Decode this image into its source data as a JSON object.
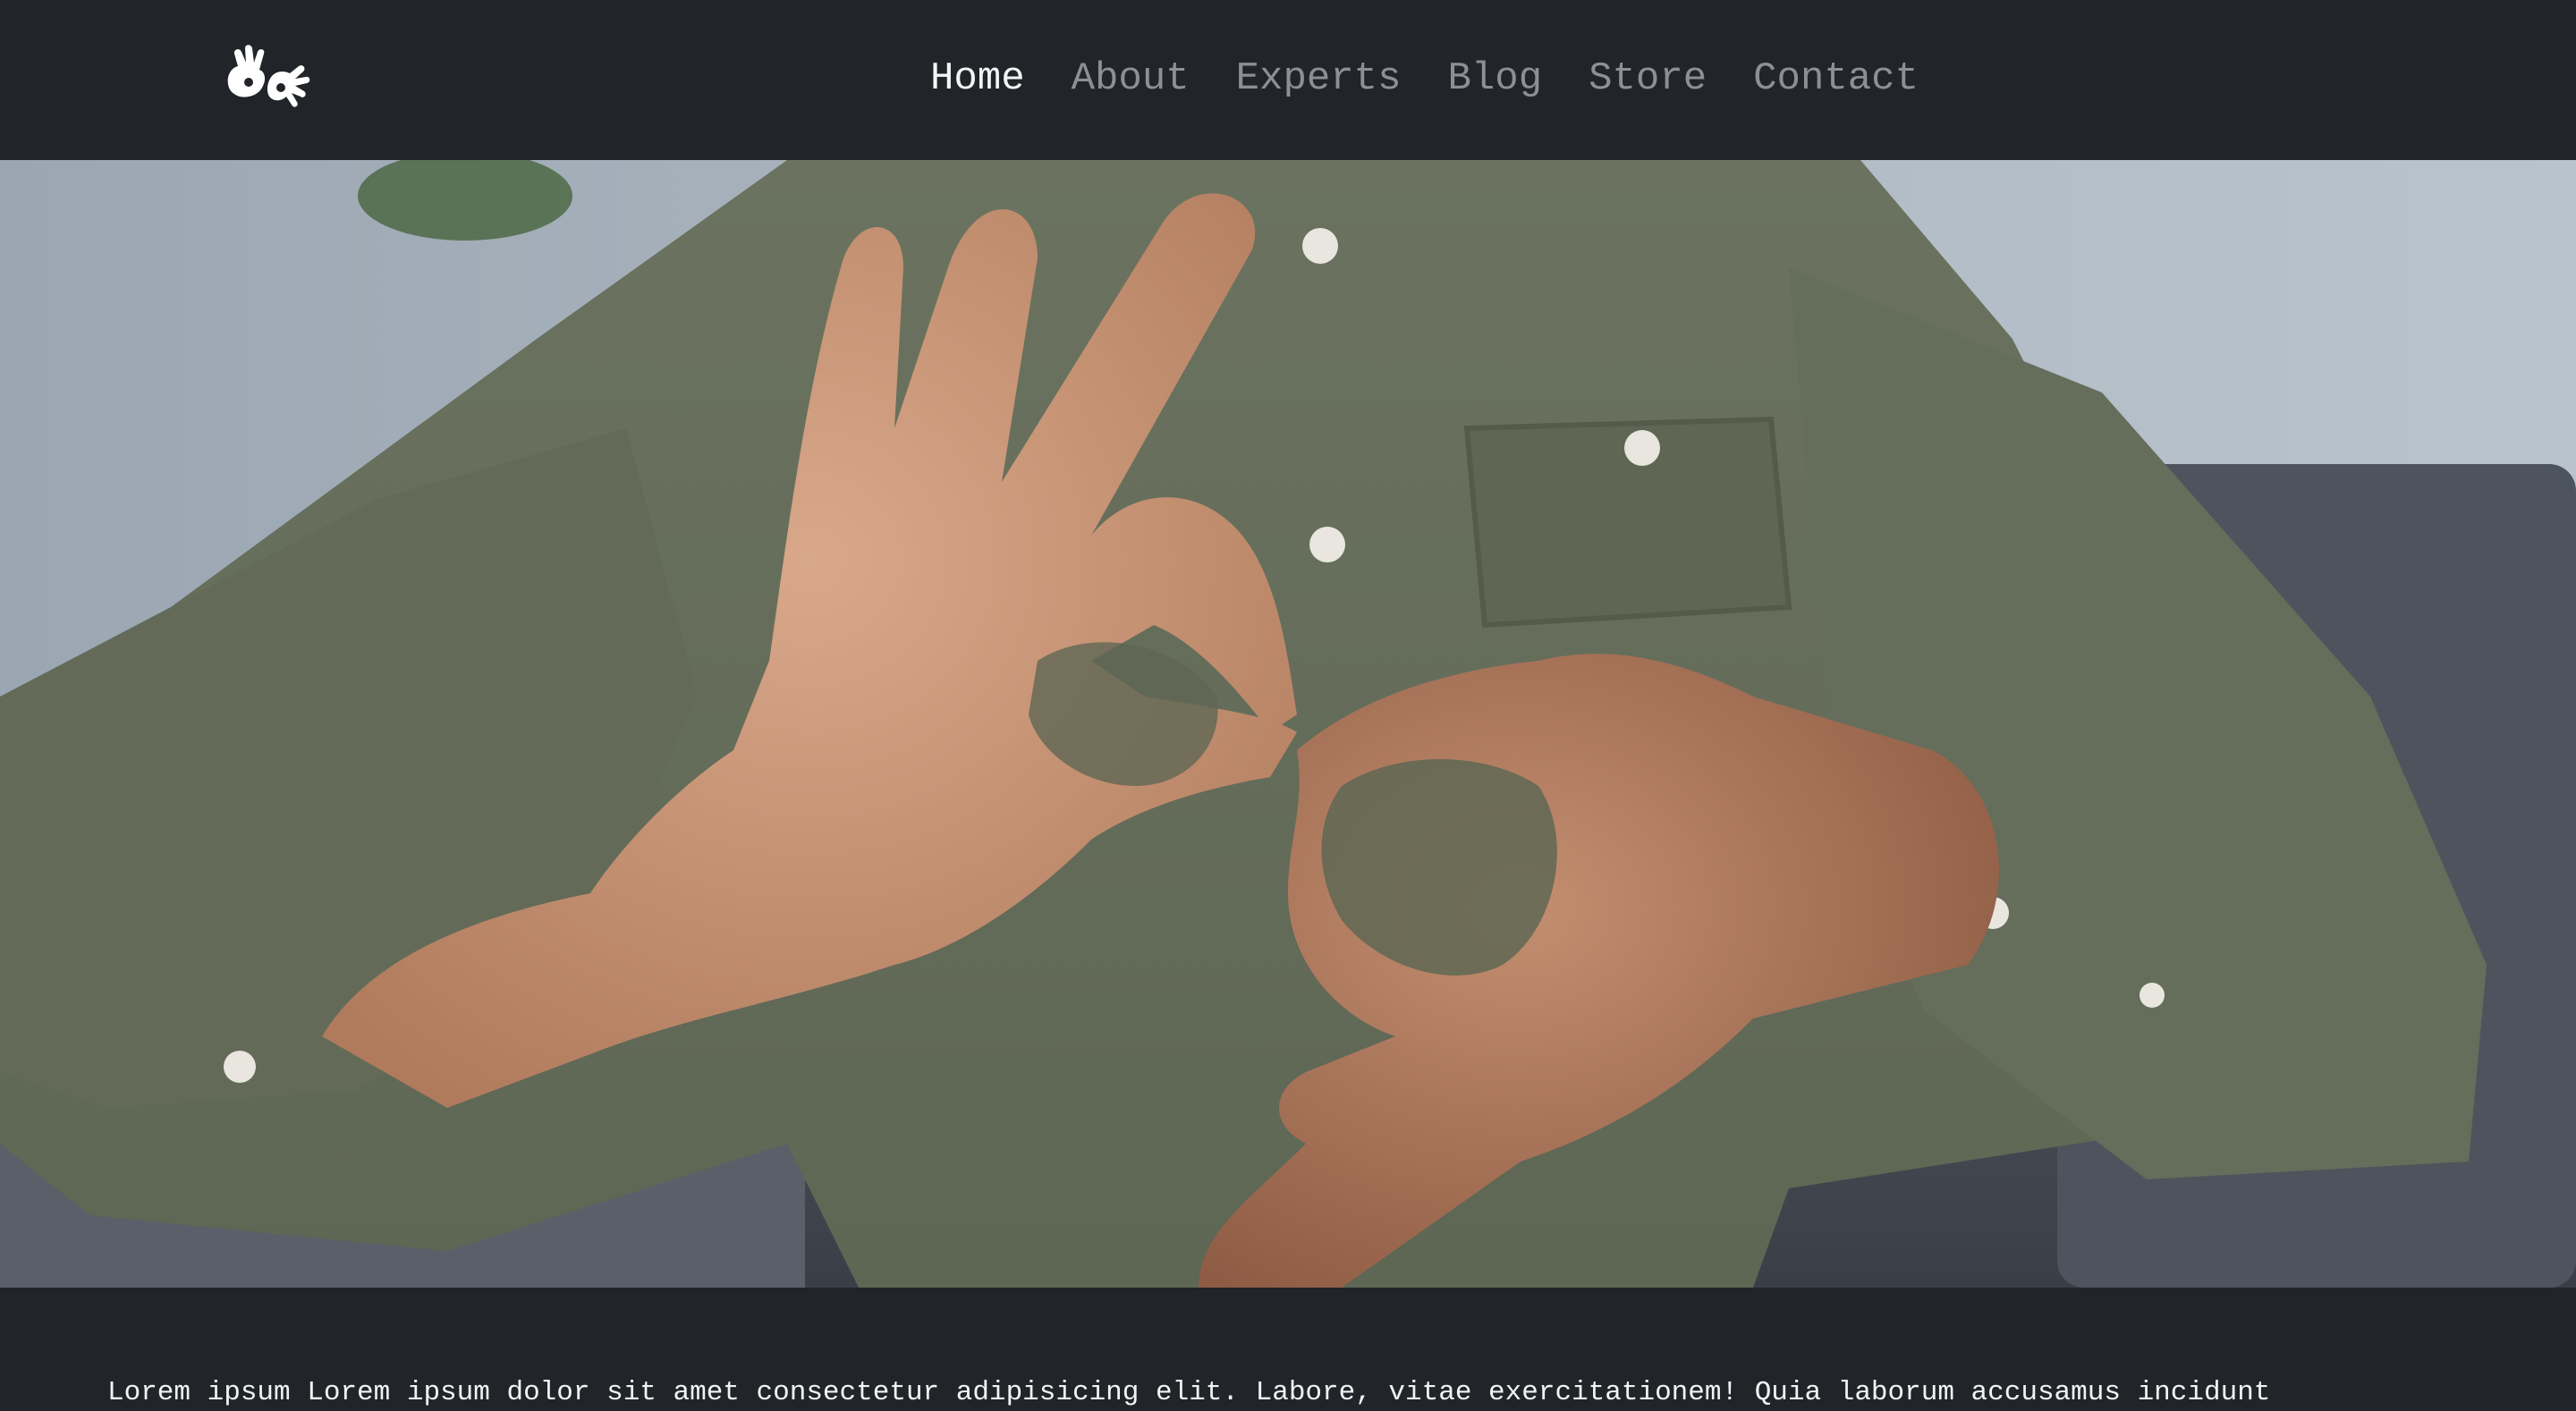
{
  "brand": {
    "logo_icon": "sign-language-hands-icon"
  },
  "nav": {
    "items": [
      {
        "label": "Home",
        "active": true
      },
      {
        "label": "About",
        "active": false
      },
      {
        "label": "Experts",
        "active": false
      },
      {
        "label": "Blog",
        "active": false
      },
      {
        "label": "Store",
        "active": false
      },
      {
        "label": "Contact",
        "active": false
      }
    ]
  },
  "hero": {
    "image_subject": "hands-signing-photo"
  },
  "content": {
    "intro_text": "Lorem ipsum Lorem ipsum dolor sit amet consectetur adipisicing elit. Labore, vitae exercitationem! Quia laborum accusamus incidunt"
  },
  "colors": {
    "nav_bg": "#212429",
    "nav_active": "#f4f4f4",
    "nav_inactive": "#8c8f94",
    "page_bg": "#212429"
  }
}
